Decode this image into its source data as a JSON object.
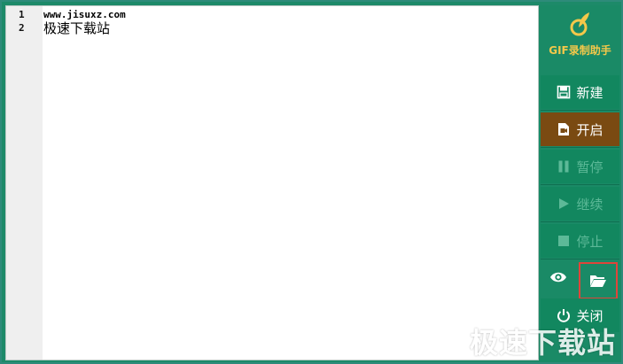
{
  "editor": {
    "lines": [
      {
        "num": "1",
        "text": "www.jisuxz.com"
      },
      {
        "num": "2",
        "text": "极速下载站"
      }
    ]
  },
  "panel": {
    "title": "GIF录制助手",
    "buttons": {
      "new": "新建",
      "start": "开启",
      "pause": "暂停",
      "resume": "继续",
      "stop": "停止",
      "close": "关闭"
    },
    "icons": {
      "preview": "eye-icon",
      "open_folder": "folder-open-icon"
    }
  },
  "watermark": "极速下载站",
  "colors": {
    "panel_bg": "#1a8a66",
    "button_bg": "#12875f",
    "active_bg": "#7a4a12",
    "title": "#f4c84a",
    "highlight": "#e0453a"
  }
}
